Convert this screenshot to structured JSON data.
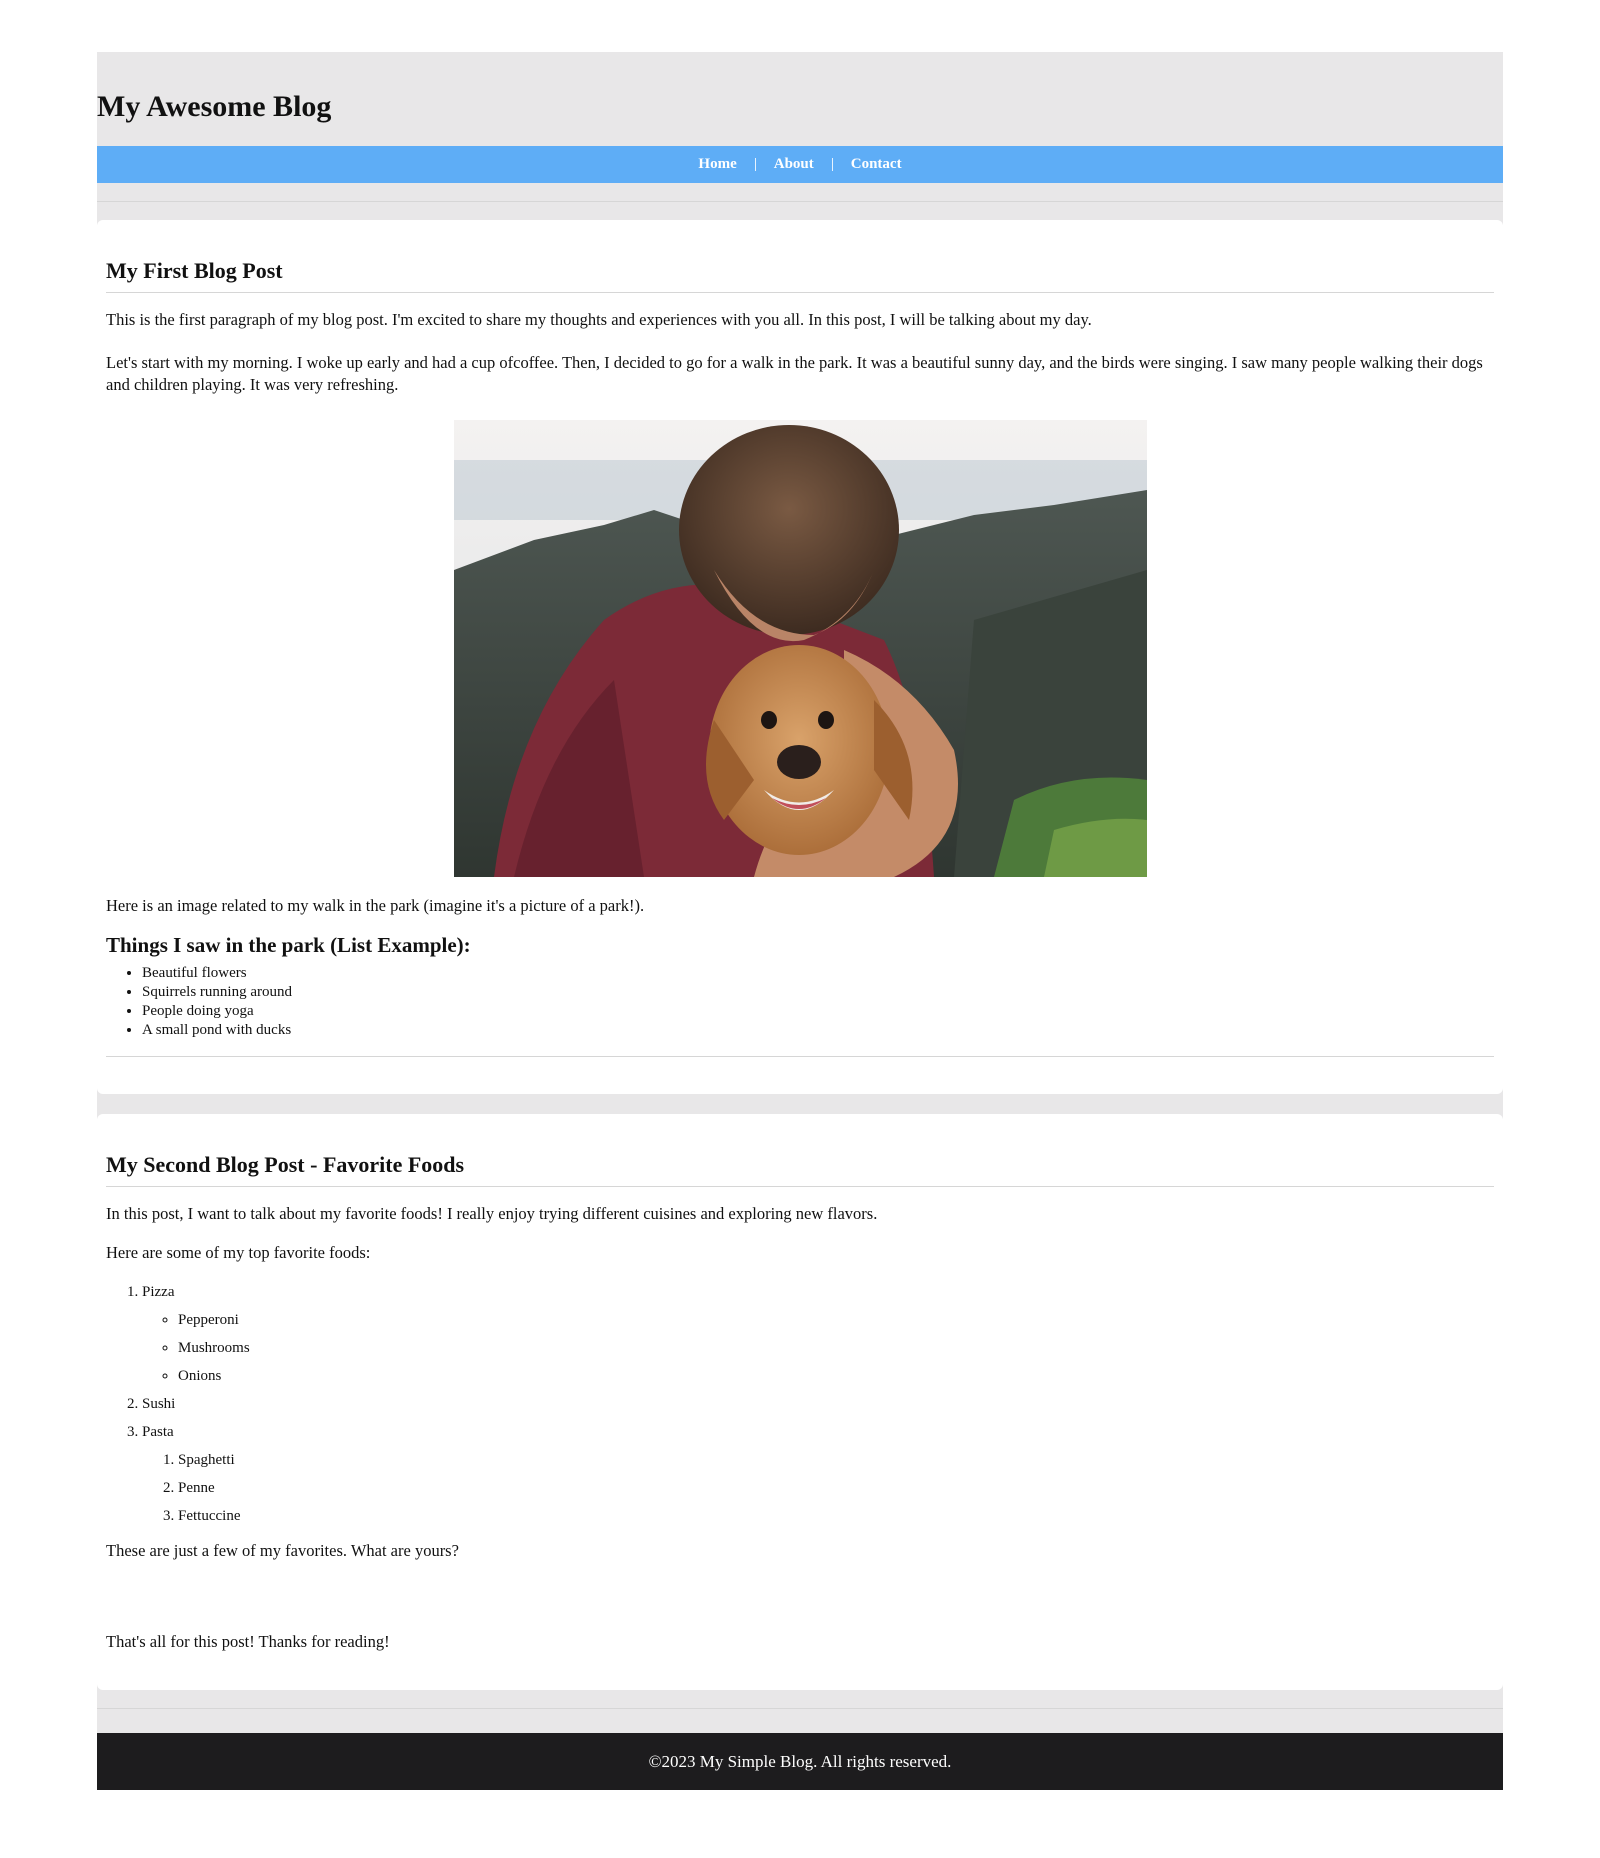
{
  "header": {
    "title": "My Awesome Blog"
  },
  "nav": {
    "items": [
      "Home",
      "About",
      "Contact"
    ]
  },
  "posts": [
    {
      "title": "My First Blog Post",
      "paragraphs": [
        "This is the first paragraph of my blog post. I'm excited to share my thoughts and experiences with you all. In this post, I will be talking about my day.",
        "Let's start with my morning. I woke up early and had a cup ofcoffee. Then, I decided to go for a walk in the park. It was a beautiful sunny day, and the birds were singing. I saw many people walking their dogs and children playing. It was very refreshing."
      ],
      "image_caption": "Here is an image related to my walk in the park (imagine it's a picture of a park!).",
      "list_heading": "Things I saw in the park (List Example):",
      "list_items": [
        "Beautiful flowers",
        "Squirrels running around",
        "People doing yoga",
        "A small pond with ducks"
      ]
    },
    {
      "title": "My Second Blog Post - Favorite Foods",
      "intro": "In this post, I want to talk about my favorite foods! I really enjoy trying different cuisines and exploring new flavors.",
      "lead": "Here are some of my top favorite foods:",
      "foods": {
        "pizza": "Pizza",
        "pizza_toppings": [
          "Pepperoni",
          "Mushrooms",
          "Onions"
        ],
        "sushi": "Sushi",
        "pasta": "Pasta",
        "pasta_types": [
          "Spaghetti",
          "Penne",
          "Fettuccine"
        ]
      },
      "closing": "These are just a few of my favorites. What are yours?",
      "signoff": "That's all for this post! Thanks for reading!"
    }
  ],
  "footer": {
    "text": "©2023 My Simple Blog. All rights reserved."
  },
  "colors": {
    "nav_bg": "#5eadf6",
    "page_bg": "#e8e7e8",
    "footer_bg": "#1d1c1e"
  }
}
